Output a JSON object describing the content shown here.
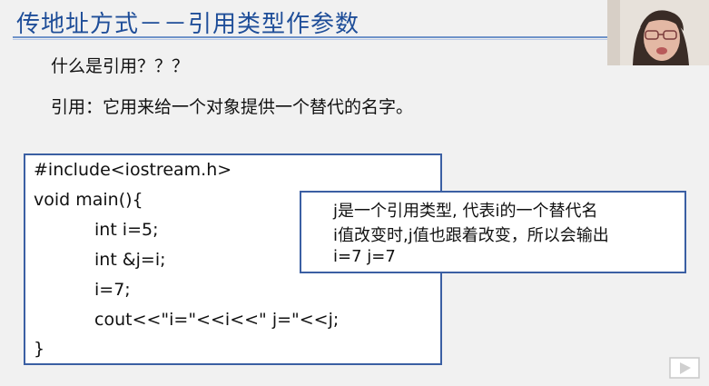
{
  "slide": {
    "title": "传地址方式－－引用类型作参数",
    "question": "什么是引用？？？",
    "definition": "引用：它用来给一个对象提供一个替代的名字。"
  },
  "code": {
    "lines": [
      "#include<iostream.h>",
      "void main(){",
      "int i=5;",
      "int &j=i;",
      "i=7;",
      "cout<<\"i=\"<<i<<\" j=\"<<j;",
      "}"
    ]
  },
  "note": {
    "lines": [
      "j是一个引用类型, 代表i的一个替代名",
      "i值改变时,j值也跟着改变，所以会输出",
      "i=7 j=7"
    ]
  },
  "icons": {
    "webcam": "presenter-webcam",
    "play": "play-icon"
  },
  "colors": {
    "title": "#1f4e99",
    "box_border": "#3b5fa3",
    "background": "#f1f1f1"
  }
}
